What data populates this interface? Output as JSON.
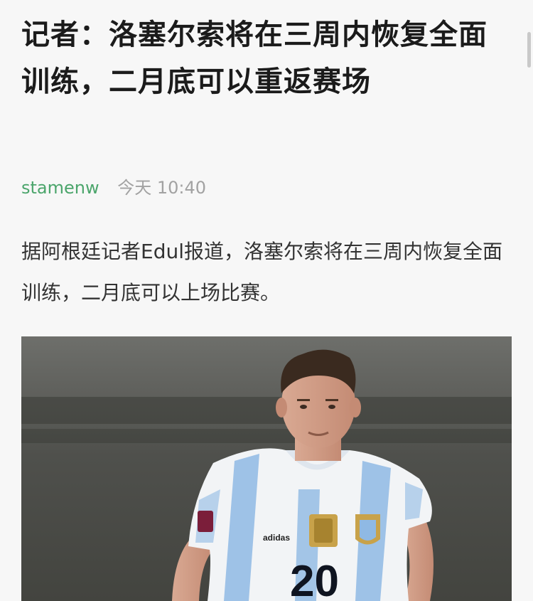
{
  "article": {
    "title": "记者：洛塞尔索将在三周内恢复全面训练，二月底可以重返赛场",
    "author": "stamenw",
    "time": "今天 10:40",
    "paragraph": "据阿根廷记者Edul报道，洛塞尔索将在三周内恢复全面训练，二月底可以上场比赛。"
  },
  "photo": {
    "jersey_number": "20",
    "kit_brand": "adidas",
    "colors": {
      "background": "#5b5c58",
      "jersey_white": "#f2f4f6",
      "jersey_blue": "#8fb9e4",
      "badge_gold": "#c8a24a"
    }
  },
  "colors": {
    "page_bg": "#f7f7f7",
    "title": "#1b1b1b",
    "author": "#4ba56b",
    "meta": "#a2a2a2",
    "body": "#333333"
  }
}
